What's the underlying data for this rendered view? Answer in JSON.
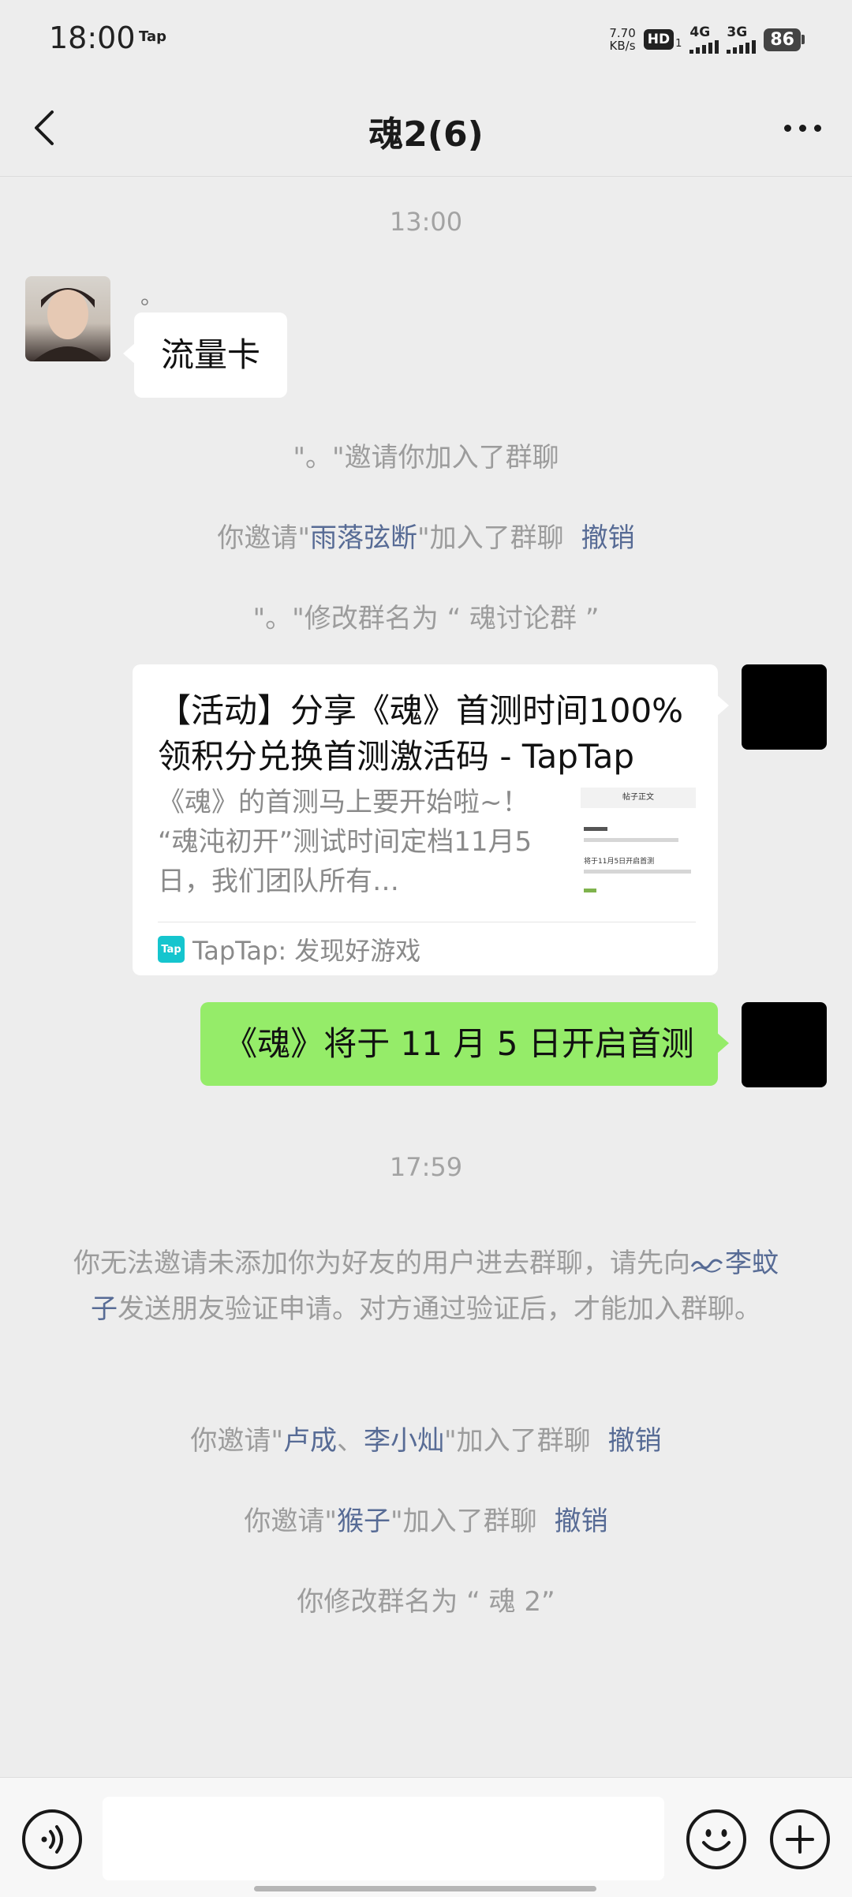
{
  "status_bar": {
    "time": "18:00",
    "app_badge": "Tap",
    "net_speed_value": "7.70",
    "net_speed_unit": "KB/s",
    "hd_label": "HD",
    "hd_sub": "1",
    "signal1_label": "4G",
    "signal2_label": "3G",
    "battery": "86"
  },
  "header": {
    "title": "魂2(6)",
    "back_icon": "chevron-left-icon",
    "more_icon": "more-dots-icon"
  },
  "messages": {
    "time1": "13:00",
    "sender_name": "。",
    "left_bubble": "流量卡",
    "sys1": "\"。\"邀请你加入了群聊",
    "sys2": {
      "pre": "你邀请\"",
      "name": "雨落弦断",
      "post": "\"加入了群聊",
      "revoke": "撤销"
    },
    "sys3": "\"。\"修改群名为 “ 魂讨论群 ”",
    "card": {
      "title": "【活动】分享《魂》首测时间100%领积分兑换首测激活码 - TapTap",
      "desc": "《魂》的首测马上要开始啦~！ “魂沌初开”测试时间定档11月5日，我们团队所有…",
      "thumb_header": "帖子正文",
      "thumb_line": "将于11月5日开启首测",
      "source": "TapTap: 发现好游戏",
      "logo_text": "Tap"
    },
    "green_bubble": "《魂》将于 11 月 5 日开启首测",
    "time2": "17:59",
    "notice": {
      "pre": "你无法邀请未添加你为好友的用户进去群聊，请先向",
      "name": "李蚊子",
      "post": "发送朋友验证申请。对方通过验证后，才能加入群聊。"
    },
    "sys4": {
      "pre": "你邀请\"",
      "name1": "卢成",
      "sep": "、",
      "name2": "李小灿",
      "post": "\"加入了群聊",
      "revoke": "撤销"
    },
    "sys5": {
      "pre": "你邀请\"",
      "name": "猴子",
      "post": "\"加入了群聊",
      "revoke": "撤销"
    },
    "sys6": "你修改群名为 “ 魂 2”"
  },
  "input_bar": {
    "voice_icon": "voice-icon",
    "emoji_icon": "emoji-icon",
    "plus_icon": "plus-icon",
    "text_value": ""
  }
}
